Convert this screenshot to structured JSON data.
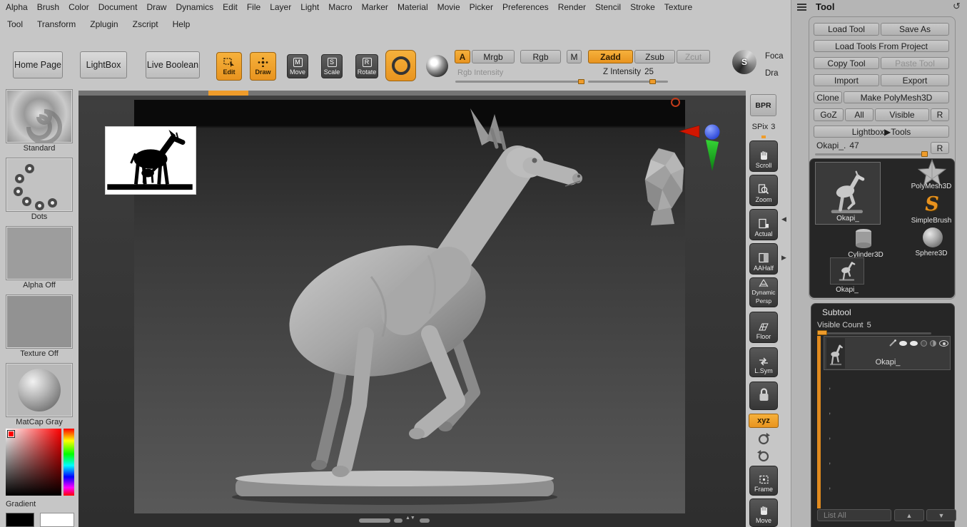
{
  "menubar": {
    "row1": [
      "Alpha",
      "Brush",
      "Color",
      "Document",
      "Draw",
      "Dynamics",
      "Edit",
      "File",
      "Layer",
      "Light",
      "Macro",
      "Marker",
      "Material",
      "Movie",
      "Picker",
      "Preferences",
      "Render",
      "Stencil",
      "Stroke",
      "Texture"
    ],
    "row2": [
      "Tool",
      "Transform",
      "Zplugin",
      "Zscript",
      "Help"
    ]
  },
  "toolbar": {
    "home_page": "Home Page",
    "lightbox": "LightBox",
    "live_boolean": "Live Boolean",
    "edit": "Edit",
    "draw": "Draw",
    "move": "Move",
    "scale": "Scale",
    "rotate": "Rotate",
    "move_letter": "M",
    "scale_letter": "S",
    "rotate_letter": "R",
    "a_toggle": "A",
    "mrgb": "Mrgb",
    "rgb": "Rgb",
    "m_toggle": "M",
    "zadd": "Zadd",
    "zsub": "Zsub",
    "zcut": "Zcut",
    "rgb_intensity_label": "Rgb Intensity",
    "z_intensity_label": "Z Intensity",
    "z_intensity_value": "25",
    "focal_label": "Foca",
    "draw_label": "Dra",
    "s_badge": "S"
  },
  "left_shelf": {
    "standard": "Standard",
    "dots": "Dots",
    "alpha_off": "Alpha Off",
    "texture_off": "Texture Off",
    "matcap": "MatCap Gray",
    "gradient": "Gradient"
  },
  "right_shelf": {
    "bpr": "BPR",
    "spix": "SPix",
    "spix_value": "3",
    "scroll": "Scroll",
    "zoom": "Zoom",
    "actual": "Actual",
    "aahalf": "AAHalf",
    "dynamic": "Dynamic",
    "persp": "Persp",
    "floor": "Floor",
    "lsym": "L.Sym",
    "xyz": "xyz",
    "frame": "Frame",
    "move": "Move"
  },
  "tool_panel": {
    "title": "Tool",
    "load_tool": "Load Tool",
    "save_as": "Save As",
    "load_tools_from_project": "Load Tools From Project",
    "copy_tool": "Copy Tool",
    "paste_tool": "Paste Tool",
    "import": "Import",
    "export": "Export",
    "clone": "Clone",
    "make_polymesh3d": "Make PolyMesh3D",
    "goz": "GoZ",
    "all": "All",
    "visible": "Visible",
    "r1": "R",
    "lightbox_tools": "Lightbox▶Tools",
    "active_slider_label": "Okapi_.",
    "active_slider_value": "47",
    "r2": "R",
    "thumb_okapi_big": "Okapi_",
    "thumb_polymesh": "PolyMesh3D",
    "thumb_simplebrush": "SimpleBrush",
    "thumb_cylinder": "Cylinder3D",
    "thumb_sphere": "Sphere3D",
    "thumb_okapi_small": "Okapi_"
  },
  "subtool": {
    "title": "Subtool",
    "visible_count_label": "Visible Count",
    "visible_count_value": "5",
    "item_label": "Okapi_",
    "list_all": "List All"
  }
}
